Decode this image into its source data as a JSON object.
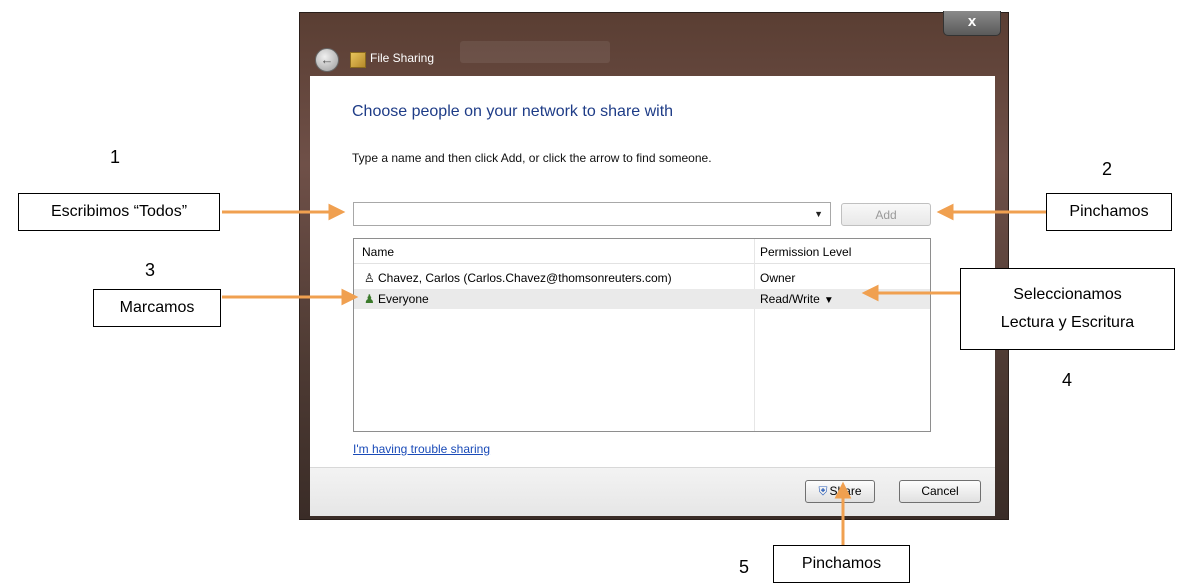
{
  "dialog": {
    "title": "File Sharing",
    "close_label": "x",
    "heading": "Choose people on your network to share with",
    "instruction": "Type a name and then click Add, or click the arrow to find someone.",
    "name_input": {
      "value": "",
      "placeholder": ""
    },
    "add_label": "Add",
    "columns": {
      "name": "Name",
      "permission": "Permission Level"
    },
    "rows": [
      {
        "icon": "user-icon",
        "name": "Chavez, Carlos (Carlos.Chavez@thomsonreuters.com)",
        "permission": "Owner"
      },
      {
        "icon": "group-icon",
        "name": "Everyone",
        "permission": "Read/Write"
      }
    ],
    "help_link": "I'm having trouble sharing",
    "share_label": "Share",
    "cancel_label": "Cancel"
  },
  "annotations": [
    {
      "number": "1",
      "text": "Escribimos “Todos”"
    },
    {
      "number": "2",
      "text": "Pinchamos"
    },
    {
      "number": "3",
      "text": "Marcamos"
    },
    {
      "number": "4",
      "line1": "Seleccionamos",
      "line2": "Lectura y Escritura"
    },
    {
      "number": "5",
      "text": "Pinchamos"
    }
  ],
  "colors": {
    "arrow": "#f0a050",
    "heading": "#1e3c87",
    "link": "#1a4bb8"
  }
}
